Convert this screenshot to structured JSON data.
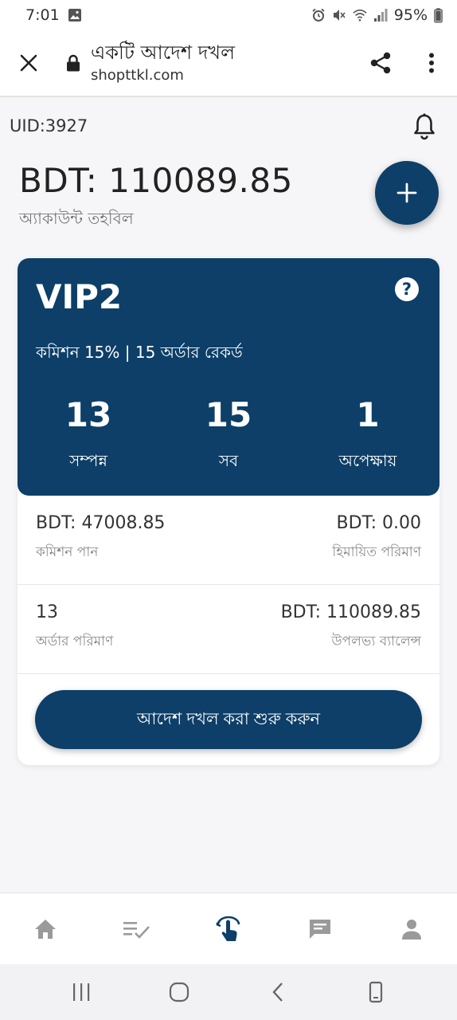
{
  "status": {
    "time": "7:01",
    "battery": "95%"
  },
  "browser": {
    "title": "একটি আদেশ দখল",
    "domain": "shopttkl.com"
  },
  "account": {
    "uid": "UID:3927",
    "balance": "BDT: 110089.85",
    "balance_label": "অ্যাকাউন্ট তহবিল"
  },
  "vip": {
    "level": "VIP2",
    "subtitle": "কমিশন 15% | 15 অর্ডার রেকর্ড",
    "help": "?",
    "stats": [
      {
        "value": "13",
        "label": "সম্পন্ন"
      },
      {
        "value": "15",
        "label": "সব"
      },
      {
        "value": "1",
        "label": "অপেক্ষায়"
      }
    ]
  },
  "details": [
    {
      "left_value": "BDT: 47008.85",
      "left_label": "কমিশন পান",
      "right_value": "BDT: 0.00",
      "right_label": "হিমায়িত পরিমাণ"
    },
    {
      "left_value": "13",
      "left_label": "অর্ডার পরিমাণ",
      "right_value": "BDT: 110089.85",
      "right_label": "উপলভ্য ব্যালেন্স"
    }
  ],
  "start_button": "আদেশ দখল করা শুরু করুন",
  "bottom_nav": [
    "home-icon",
    "task-list-icon",
    "grab-order-icon",
    "message-icon",
    "profile-icon"
  ],
  "colors": {
    "primary": "#0d3f68",
    "background": "#f6f6f8",
    "nav_active": "#0d3f68",
    "nav_inactive": "#9a9a9a"
  }
}
